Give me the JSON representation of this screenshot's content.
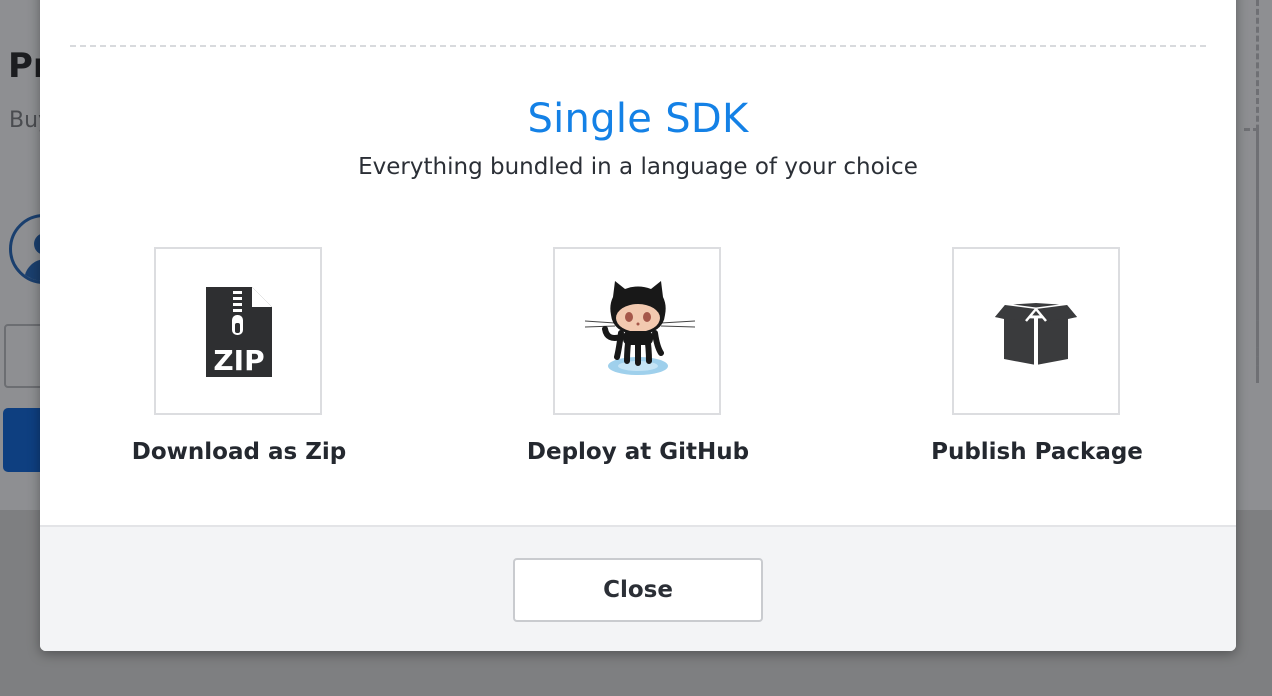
{
  "background": {
    "title_fragment": "Pr",
    "subtitle_fragment": "Buy"
  },
  "modal": {
    "section_title": "Single SDK",
    "section_subtitle": "Everything bundled in a language of your choice",
    "options": [
      {
        "label": "Download as Zip",
        "icon": "zip-file-icon"
      },
      {
        "label": "Deploy at GitHub",
        "icon": "github-octocat-icon"
      },
      {
        "label": "Publish Package",
        "icon": "package-box-icon"
      }
    ],
    "zip_icon_text": "ZIP",
    "close_label": "Close"
  },
  "colors": {
    "accent_blue": "#1481e6",
    "text_dark": "#24282f",
    "footer_bg": "#f3f4f6",
    "overlay": "#7e7f81"
  }
}
